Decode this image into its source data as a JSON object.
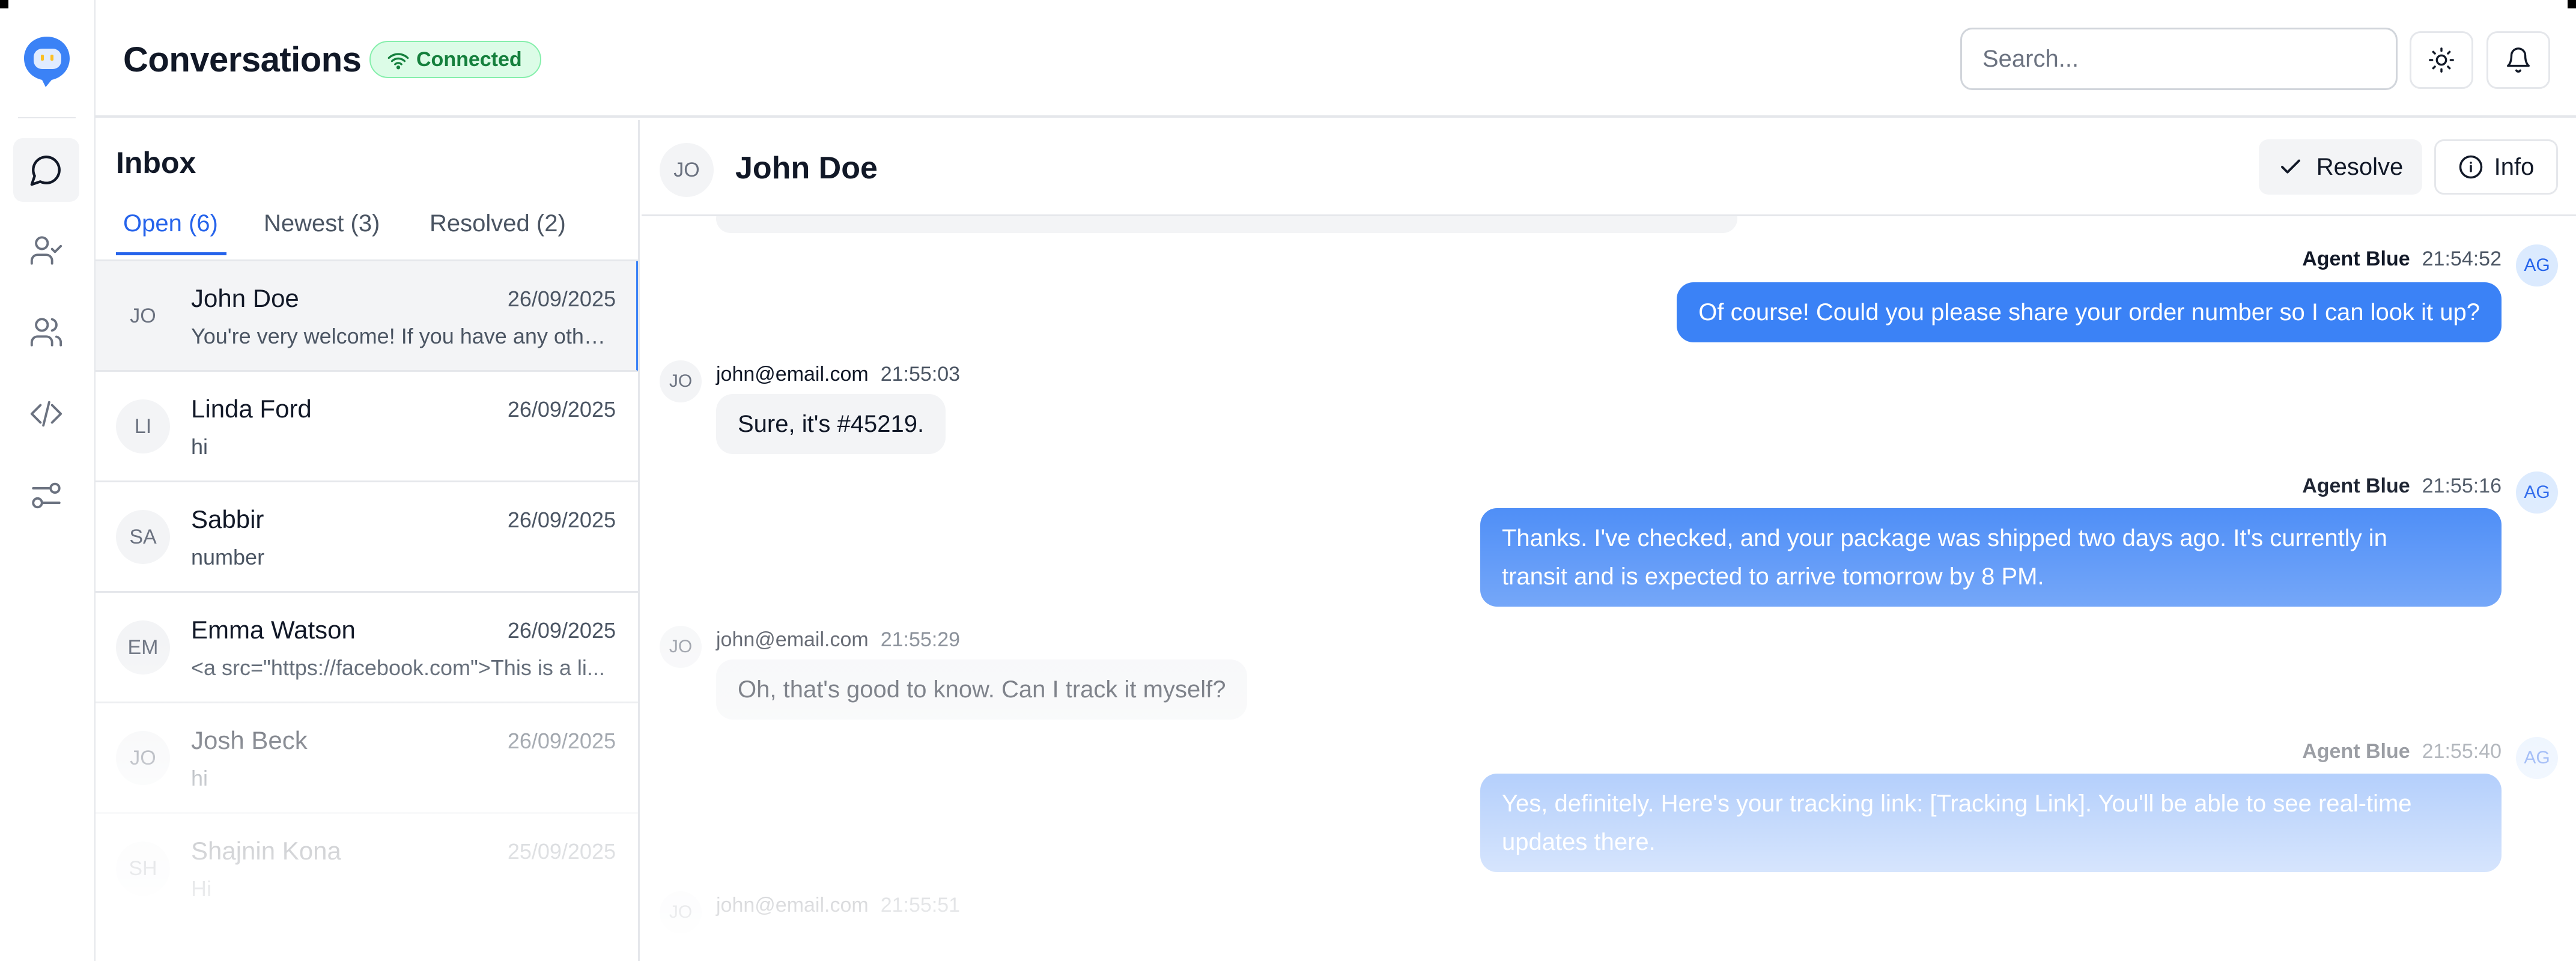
{
  "header": {
    "title": "Conversations",
    "status": "Connected",
    "search_placeholder": "Search..."
  },
  "rail": {
    "items": [
      {
        "name": "chat-icon",
        "active": true
      },
      {
        "name": "user-check-icon",
        "active": false
      },
      {
        "name": "users-icon",
        "active": false
      },
      {
        "name": "code-icon",
        "active": false
      },
      {
        "name": "sliders-icon",
        "active": false
      }
    ]
  },
  "inbox": {
    "title": "Inbox",
    "tabs": [
      {
        "label": "Open (6)",
        "active": true
      },
      {
        "label": "Newest (3)",
        "active": false
      },
      {
        "label": "Resolved (2)",
        "active": false
      }
    ],
    "conversations": [
      {
        "initials": "JO",
        "name": "John Doe",
        "date": "26/09/2025",
        "preview": "You're very welcome! If you have any othe..."
      },
      {
        "initials": "LI",
        "name": "Linda Ford",
        "date": "26/09/2025",
        "preview": "hi"
      },
      {
        "initials": "SA",
        "name": "Sabbir",
        "date": "26/09/2025",
        "preview": "number"
      },
      {
        "initials": "EM",
        "name": "Emma Watson",
        "date": "26/09/2025",
        "preview": "<a src=\"https://facebook.com\">This is a li..."
      },
      {
        "initials": "JO",
        "name": "Josh Beck",
        "date": "26/09/2025",
        "preview": "hi"
      },
      {
        "initials": "SH",
        "name": "Shajnin Kona",
        "date": "25/09/2025",
        "preview": "Hi"
      }
    ]
  },
  "chat": {
    "contact_initials": "JO",
    "contact_name": "John Doe",
    "resolve_label": "Resolve",
    "info_label": "Info",
    "messages": [
      {
        "sender": "Agent Blue",
        "time": "21:54:52",
        "initials": "AG",
        "text": "Of course! Could you please share your order number so I can look it up?"
      },
      {
        "sender": "john@email.com",
        "time": "21:55:03",
        "initials": "JO",
        "text": "Sure, it's #45219."
      },
      {
        "sender": "Agent Blue",
        "time": "21:55:16",
        "initials": "AG",
        "line1": "Thanks. I've checked, and your package was shipped two days ago. It's currently in",
        "line2": "transit and is expected to arrive tomorrow by 8 PM."
      },
      {
        "sender": "john@email.com",
        "time": "21:55:29",
        "initials": "JO",
        "text": "Oh, that's good to know. Can I track it myself?"
      },
      {
        "sender": "Agent Blue",
        "time": "21:55:40",
        "initials": "AG",
        "line1": "Yes, definitely. Here's your tracking link: [Tracking Link]. You'll be able to see real-time",
        "line2": "updates there."
      },
      {
        "sender": "john@email.com",
        "time": "21:55:51",
        "initials": "JO"
      }
    ]
  },
  "colors": {
    "accent": "#3b82f6",
    "status_bg": "#dcfce7",
    "status_text": "#15803d"
  }
}
